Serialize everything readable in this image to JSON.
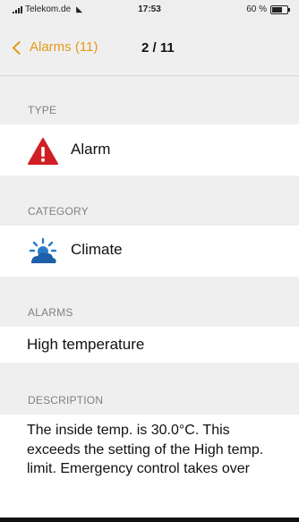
{
  "status_bar": {
    "carrier": "Telekom.de",
    "time": "17:53",
    "battery": "60 %",
    "battery_level": 0.6
  },
  "nav": {
    "back_label": "Alarms (11)",
    "pager": "2 / 11"
  },
  "sections": {
    "type": {
      "header": "TYPE",
      "value": "Alarm",
      "icon": "warning-triangle-icon",
      "icon_color": "#d01f25"
    },
    "category": {
      "header": "CATEGORY",
      "value": "Climate",
      "icon": "climate-sun-cloud-icon",
      "icon_color": "#2b7bc8"
    },
    "alarms": {
      "header": "ALARMS",
      "value": "High temperature"
    },
    "description": {
      "header": "DESCRIPTION",
      "value": "The inside temp. is 30.0°C. This exceeds the setting of the High temp. limit. Emergency control takes over"
    }
  },
  "colors": {
    "accent": "#e39a1c",
    "group_background": "#efefef",
    "header_text": "#808080"
  }
}
